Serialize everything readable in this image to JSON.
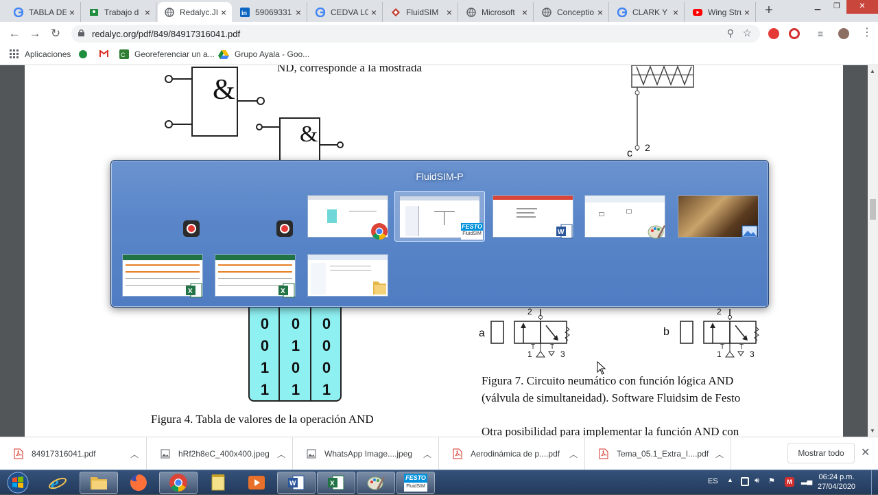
{
  "browser": {
    "tabs": [
      {
        "title": "TABLA DE",
        "favicon": "google-icon",
        "active": false
      },
      {
        "title": "Trabajo d",
        "favicon": "classroom-icon",
        "active": false
      },
      {
        "title": "Redalyc.JIi",
        "favicon": "globe-icon",
        "active": true
      },
      {
        "title": "59069331",
        "favicon": "linkedin-icon",
        "active": false
      },
      {
        "title": "CEDVA LC",
        "favicon": "google-icon",
        "active": false
      },
      {
        "title": "FluidSIM",
        "favicon": "festo-icon",
        "active": false
      },
      {
        "title": "Microsoft",
        "favicon": "globe-icon",
        "active": false
      },
      {
        "title": "Conceptio",
        "favicon": "globe-icon",
        "active": false
      },
      {
        "title": "CLARK Y",
        "favicon": "google-icon",
        "active": false
      },
      {
        "title": "Wing Stru",
        "favicon": "youtube-icon",
        "active": false
      }
    ],
    "url": "redalyc.org/pdf/849/84917316041.pdf",
    "bookmarks": [
      {
        "label": "Aplicaciones",
        "icon": "apps-grid-icon"
      },
      {
        "label": "",
        "icon": "green-circle-icon"
      },
      {
        "label": "",
        "icon": "gmail-icon"
      },
      {
        "label": "Georeferenciar un a...",
        "icon": "site-icon"
      },
      {
        "label": "Grupo Ayala - Goo...",
        "icon": "drive-icon"
      }
    ]
  },
  "document": {
    "fragment_text": "ND, corresponde a la mostrada",
    "gate1_symbol": "&",
    "gate2_symbol": "&",
    "label_c": "c",
    "label_2_top": "2",
    "valve_a": {
      "label": "a",
      "port_top": "2",
      "port_left": "1",
      "port_right": "3"
    },
    "valve_b": {
      "label": "b",
      "port_top": "2",
      "port_left": "1",
      "port_right": "3"
    },
    "truth_table": {
      "rows": [
        [
          "0",
          "0",
          "0"
        ],
        [
          "0",
          "1",
          "0"
        ],
        [
          "1",
          "0",
          "0"
        ],
        [
          "1",
          "1",
          "1"
        ]
      ]
    },
    "figure4_caption": "Figura 4. Tabla de valores de la operación AND",
    "figure7_caption_line1": "Figura 7. Circuito neumático con función lógica AND",
    "figure7_caption_line2": "(válvula de simultaneidad). Software Fluidsim de Festo",
    "paragraph_start": "Otra posibilidad para implementar la función AND con"
  },
  "switcher": {
    "title": "FluidSIM-P",
    "windows": [
      {
        "app": "recorder",
        "badge": "record-icon"
      },
      {
        "app": "recorder",
        "badge": "record-icon"
      },
      {
        "app": "chrome",
        "badge": "chrome-icon"
      },
      {
        "app": "fluidsim",
        "badge": "festo-fluidsim-icon",
        "badge_text": "FESTO",
        "badge_sub": "FluidSIM",
        "selected": true
      },
      {
        "app": "word",
        "badge": "word-icon"
      },
      {
        "app": "paint",
        "badge": "paint-icon"
      },
      {
        "app": "photo-viewer",
        "badge": "photo-viewer-icon"
      },
      {
        "app": "excel",
        "badge": "excel-icon"
      },
      {
        "app": "excel",
        "badge": "excel-icon"
      },
      {
        "app": "explorer",
        "badge": "folder-icon"
      }
    ]
  },
  "downloads": {
    "items": [
      {
        "name": "84917316041.pdf",
        "icon": "pdf-icon"
      },
      {
        "name": "hRf2h8eC_400x400.jpeg",
        "icon": "image-icon"
      },
      {
        "name": "WhatsApp Image....jpeg",
        "icon": "image-icon"
      },
      {
        "name": "Aerodinámica de p....pdf",
        "icon": "pdf-icon"
      },
      {
        "name": "Tema_05.1_Extra_I....pdf",
        "icon": "pdf-icon"
      }
    ],
    "show_all": "Mostrar todo"
  },
  "taskbar": {
    "apps": [
      "ie-icon",
      "explorer-icon",
      "firefox-icon",
      "chrome-icon",
      "notes-icon",
      "media-icon",
      "word-icon",
      "excel-icon",
      "paint-icon",
      "festo-fluidsim-icon"
    ],
    "fluidsim_badge": "FESTO",
    "fluidsim_sub": "FluidSIM",
    "language": "ES",
    "time": "06:24 p.m.",
    "date": "27/04/2020"
  },
  "colors": {
    "switcher": "#5a86c9",
    "truth_table": "#8ff0f2",
    "taskbar": "#2a4466",
    "active_tab": "#ffffff"
  }
}
